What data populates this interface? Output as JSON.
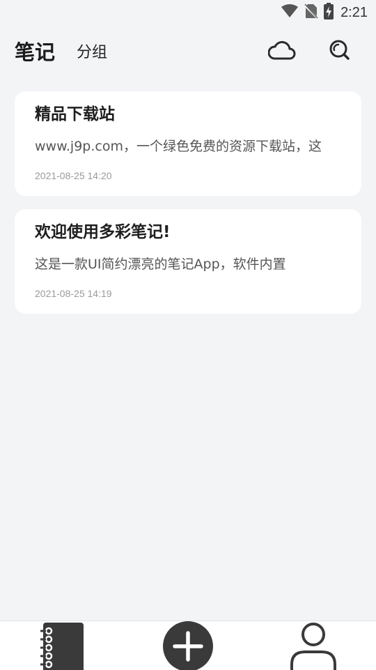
{
  "status_bar": {
    "time": "2:21",
    "icons": [
      "wifi-icon",
      "no-sim-icon",
      "battery-charging-icon"
    ]
  },
  "header": {
    "title": "笔记",
    "groups_tab": "分组",
    "actions": [
      "cloud-icon",
      "search-icon"
    ]
  },
  "notes": [
    {
      "title": "精品下载站",
      "preview": "www.j9p.com，一个绿色免费的资源下载站，这",
      "time": "2021-08-25 14:20"
    },
    {
      "title": "欢迎使用多彩笔记!",
      "preview": "这是一款UI简约漂亮的笔记App，软件内置",
      "time": "2021-08-25 14:19"
    }
  ],
  "bottom_nav": {
    "items": [
      "notebook-icon",
      "add-icon",
      "profile-icon"
    ]
  },
  "colors": {
    "background": "#f3f4f6",
    "card": "#ffffff",
    "icon_dark": "#3a3a3a"
  }
}
